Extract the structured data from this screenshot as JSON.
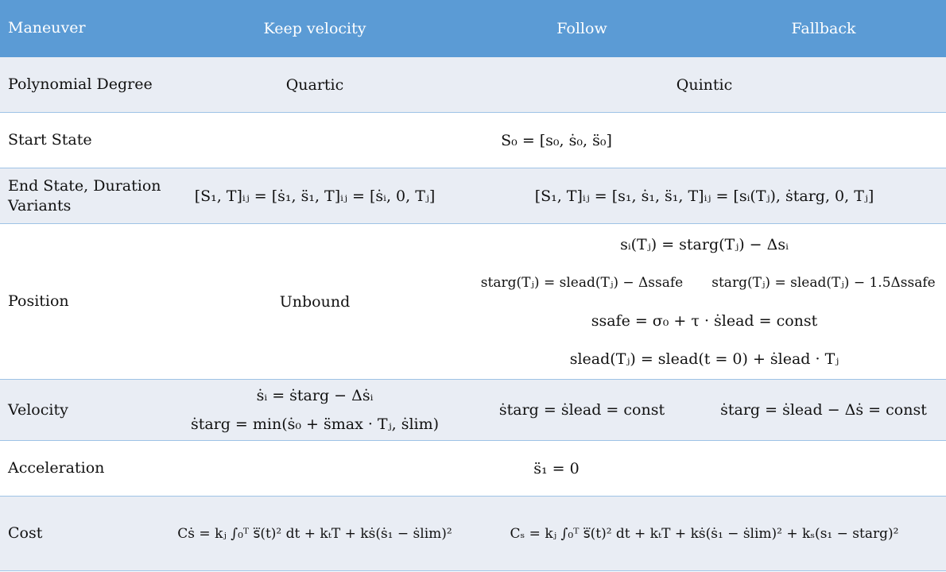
{
  "header": {
    "maneuver": "Maneuver",
    "keep_velocity": "Keep velocity",
    "follow": "Follow",
    "fallback": "Fallback"
  },
  "rows": {
    "polynomial": {
      "label": "Polynomial Degree",
      "keep": "Quartic",
      "follow_fallback": "Quintic"
    },
    "start_state": {
      "label": "Start State",
      "value": "S₀ = [s₀, ṡ₀, s̈₀]"
    },
    "end_state": {
      "label": "End State, Duration Variants",
      "keep": "[S₁, T]ᵢⱼ = [ṡ₁, s̈₁, T]ᵢⱼ = [ṡᵢ, 0, Tⱼ]",
      "follow_fallback": "[S₁, T]ᵢⱼ = [s₁, ṡ₁, s̈₁, T]ᵢⱼ = [sᵢ(Tⱼ), ṡtarg, 0, Tⱼ]"
    },
    "position": {
      "label": "Position",
      "keep": "Unbound",
      "line1": "sᵢ(Tⱼ) = starg(Tⱼ) − Δsᵢ",
      "follow": "starg(Tⱼ) = slead(Tⱼ) − Δssafe",
      "fallback": "starg(Tⱼ) = slead(Tⱼ) − 1.5Δssafe",
      "line3": "ssafe = σ₀ + τ · ṡlead = const",
      "line4": "slead(Tⱼ) = slead(t = 0) + ṡlead · Tⱼ"
    },
    "velocity": {
      "label": "Velocity",
      "keep_line1": "ṡᵢ = ṡtarg − Δṡᵢ",
      "keep_line2": "ṡtarg = min(ṡ₀ + s̈max · Tⱼ, ṡlim)",
      "follow": "ṡtarg = ṡlead = const",
      "fallback": "ṡtarg = ṡlead − Δṡ = const"
    },
    "acceleration": {
      "label": "Acceleration",
      "value": "s̈₁ = 0"
    },
    "cost": {
      "label": "Cost",
      "keep": "Cṡ = kⱼ ∫₀ᵀ s⃛(t)² dt + kₜT + kṡ(ṡ₁ − ṡlim)²",
      "follow_fallback": "Cₛ = kⱼ ∫₀ᵀ s⃛(t)² dt + kₜT + kṡ(ṡ₁ − ṡlim)² + kₛ(s₁ − starg)²"
    }
  },
  "colors": {
    "header_bg": "#5b9bd5",
    "alt_row_bg": "#e9edf4",
    "border": "#9ec3e6"
  }
}
